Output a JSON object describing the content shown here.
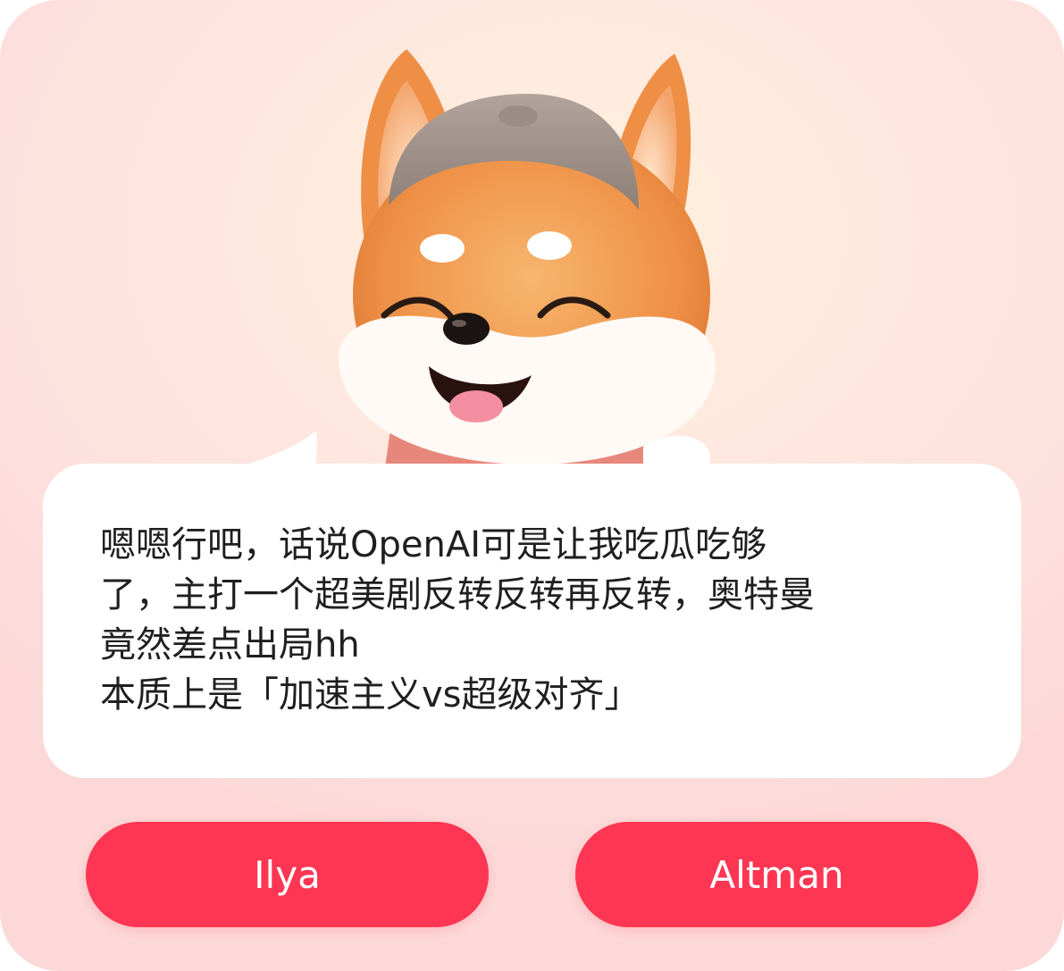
{
  "dialog": {
    "message": "嗯嗯行吧，话说OpenAI可是让我吃瓜吃够\n了，主打一个超美剧反转反转再反转，奥特曼\n竟然差点出局hh\n本质上是「加速主义vs超级对齐」"
  },
  "choices": {
    "left_label": "Ilya",
    "right_label": "Altman"
  },
  "colors": {
    "button": "#fe3653",
    "bubble": "#ffffff",
    "text": "#1f1f1f"
  },
  "icons": {
    "mascot": "shiba-dog-with-beanie"
  }
}
